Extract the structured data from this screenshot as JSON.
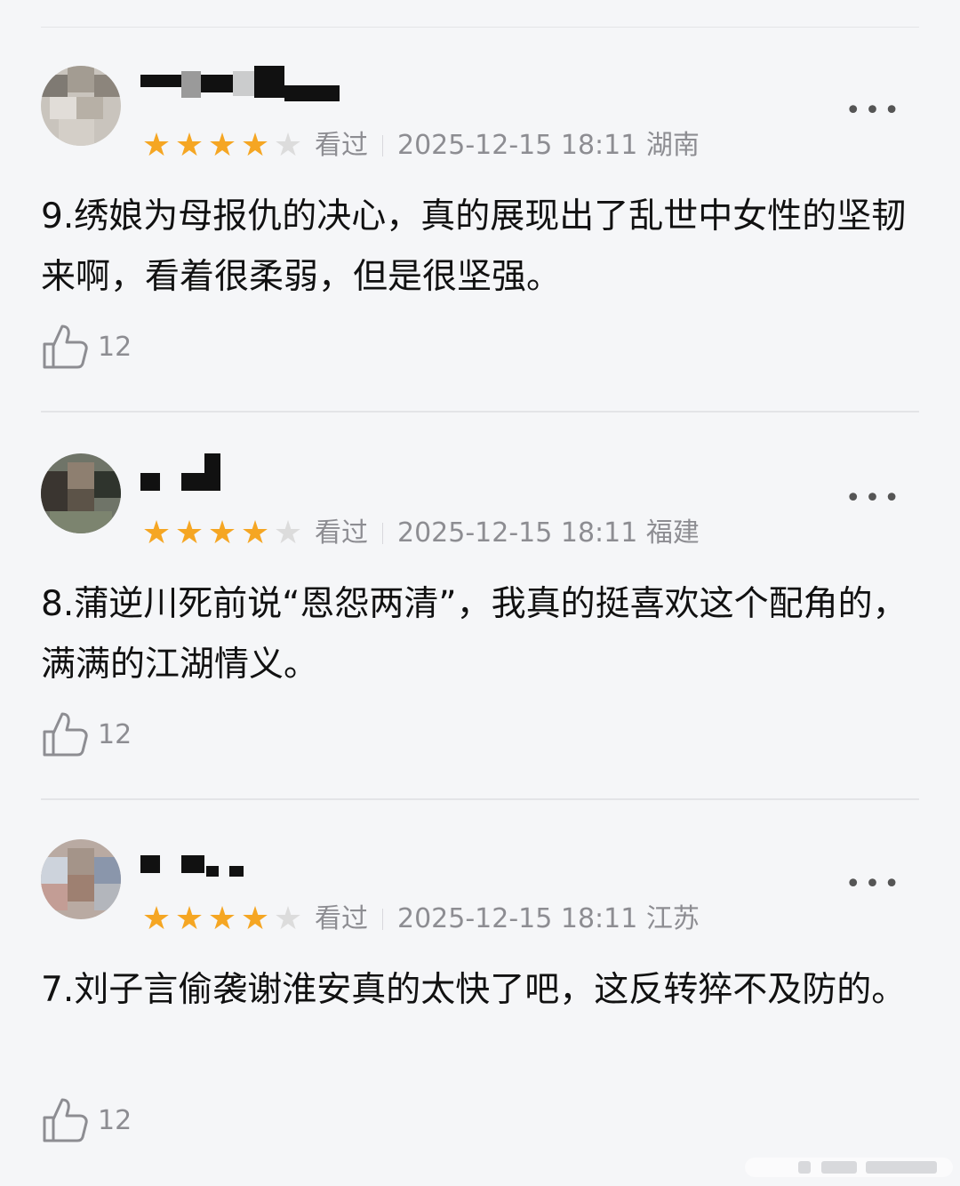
{
  "reviews": [
    {
      "rating": 4,
      "max_rating": 5,
      "status": "看过",
      "datetime": "2025-12-15 18:11",
      "location": "湖南",
      "content": "9.绣娘为母报仇的决心，真的展现出了乱世中女性的坚韧来啊，看着很柔弱，但是很坚强。",
      "likes": "12"
    },
    {
      "rating": 4,
      "max_rating": 5,
      "status": "看过",
      "datetime": "2025-12-15 18:11",
      "location": "福建",
      "content": "8.蒲逆川死前说“恩怨两清”，我真的挺喜欢这个配角的，满满的江湖情义。",
      "likes": "12"
    },
    {
      "rating": 4,
      "max_rating": 5,
      "status": "看过",
      "datetime": "2025-12-15 18:11",
      "location": "江苏",
      "content": "7.刘子言偷袭谢淮安真的太快了吧，这反转猝不及防的。",
      "likes": "12"
    }
  ],
  "icons": {
    "more": "more-dots-icon",
    "like": "thumbs-up-icon",
    "star": "star-icon"
  },
  "colors": {
    "star_on": "#f5a623",
    "star_off": "#dcdcdc",
    "meta_text": "#8d8d92"
  }
}
